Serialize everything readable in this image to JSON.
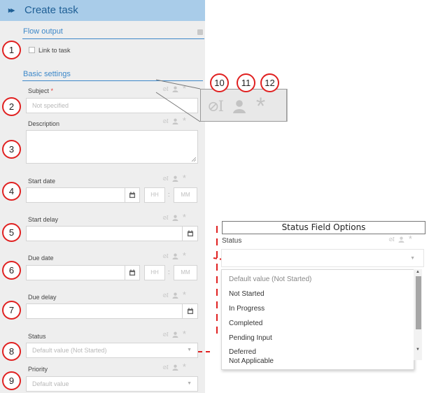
{
  "header": {
    "title": "Create task"
  },
  "flow_output": {
    "title": "Flow output",
    "link_to_task_label": "Link to task"
  },
  "basic": {
    "title": "Basic settings",
    "subject": {
      "label": "Subject",
      "required_mark": "*",
      "placeholder": "Not specified"
    },
    "description": {
      "label": "Description"
    },
    "start_date": {
      "label": "Start date",
      "hh": "HH",
      "mm": "MM"
    },
    "start_delay": {
      "label": "Start delay"
    },
    "due_date": {
      "label": "Due date",
      "hh": "HH",
      "mm": "MM"
    },
    "due_delay": {
      "label": "Due delay"
    },
    "status": {
      "label": "Status",
      "placeholder": "Default value (Not Started)"
    },
    "priority": {
      "label": "Priority",
      "placeholder": "Default value"
    }
  },
  "field_icons": {
    "variable": "⊘I",
    "user": "user-icon",
    "required": "*"
  },
  "callouts": [
    "1",
    "2",
    "3",
    "4",
    "5",
    "6",
    "7",
    "8",
    "9",
    "10",
    "11",
    "12"
  ],
  "status_options": {
    "title": "Status Field Options",
    "field_label": "Status",
    "items": [
      "Default value (Not Started)",
      "Not Started",
      "In Progress",
      "Completed",
      "Pending Input",
      "Deferred",
      "Not Applicable"
    ]
  },
  "colors": {
    "header_bg": "#a9cce9",
    "accent": "#3d88c9",
    "callout": "#e02020"
  }
}
